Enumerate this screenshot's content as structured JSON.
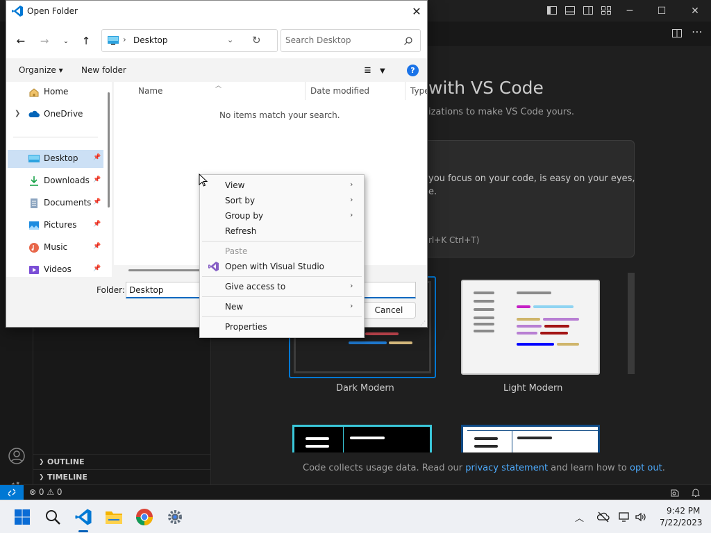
{
  "vscode": {
    "welcome_title": "with VS Code",
    "welcome_subtitle": "izations to make VS Code yours.",
    "theme_desc_line1": "you focus on your code, is easy on your eyes,",
    "theme_desc_line2": "e.",
    "theme_shortcut": "rl+K Ctrl+T)",
    "theme_dark_label": "Dark Modern",
    "theme_light_label": "Light Modern",
    "telemetry_prefix": "Code collects usage data. Read our ",
    "telemetry_privacy_link": "privacy statement",
    "telemetry_middle": " and learn how to ",
    "telemetry_optout_link": "opt out",
    "telemetry_suffix": ".",
    "sidebar_sections": [
      "OUTLINE",
      "TIMELINE"
    ],
    "status_problems": "⊗ 0 ⚠ 0",
    "accent_color": "#0078d4"
  },
  "dialog": {
    "title": "Open Folder",
    "address_text": "Desktop",
    "search_placeholder": "Search Desktop",
    "organize_label": "Organize ▾",
    "new_folder_label": "New folder",
    "help_label": "?",
    "nav_items": [
      {
        "label": "Home",
        "icon": "home-icon",
        "pinned": false
      },
      {
        "label": "OneDrive",
        "icon": "onedrive-icon",
        "pinned": false
      },
      {
        "label": "Desktop",
        "icon": "desktop-icon",
        "pinned": true,
        "selected": true
      },
      {
        "label": "Downloads",
        "icon": "downloads-icon",
        "pinned": true
      },
      {
        "label": "Documents",
        "icon": "documents-icon",
        "pinned": true
      },
      {
        "label": "Pictures",
        "icon": "pictures-icon",
        "pinned": true
      },
      {
        "label": "Music",
        "icon": "music-icon",
        "pinned": true
      },
      {
        "label": "Videos",
        "icon": "videos-icon",
        "pinned": true
      }
    ],
    "columns": [
      "Name",
      "Date modified",
      "Type"
    ],
    "empty_message": "No items match your search.",
    "folder_label": "Folder:",
    "folder_value": "Desktop",
    "cancel_label": "Cancel"
  },
  "context_menu": {
    "items": [
      {
        "label": "View",
        "submenu": true
      },
      {
        "label": "Sort by",
        "submenu": true
      },
      {
        "label": "Group by",
        "submenu": true
      },
      {
        "label": "Refresh",
        "submenu": false
      },
      {
        "label": "Paste",
        "submenu": false,
        "disabled": true
      },
      {
        "label": "Open with Visual Studio",
        "submenu": false,
        "icon": "visual-studio-icon"
      },
      {
        "label": "Give access to",
        "submenu": true
      },
      {
        "label": "New",
        "submenu": true
      },
      {
        "label": "Properties",
        "submenu": false
      }
    ]
  },
  "taskbar": {
    "apps": [
      "start-icon",
      "search-icon",
      "vscode-icon",
      "file-explorer-icon",
      "chrome-icon",
      "settings-icon"
    ],
    "time": "9:42 PM",
    "date": "7/22/2023"
  }
}
